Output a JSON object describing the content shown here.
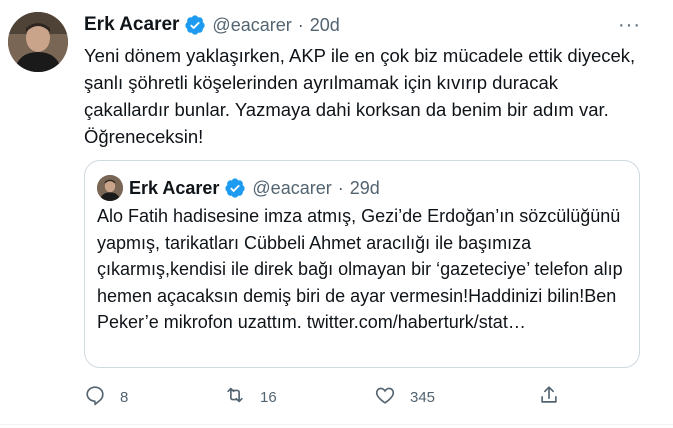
{
  "tweet": {
    "author_name": "Erk Acarer",
    "handle": "@eacarer",
    "separator": "·",
    "time": "20d",
    "more": "···",
    "text": "Yeni dönem yaklaşırken, AKP ile en çok biz mücadele ettik diyecek, şanlı şöhretli köşelerinden ayrılmamak için kıvırıp duracak çakallardır bunlar. Yazmaya dahi korksan da benim bir adım var. Öğreneceksin!"
  },
  "quoted": {
    "author_name": "Erk Acarer",
    "handle": "@eacarer",
    "separator": "·",
    "time": "29d",
    "text": "Alo Fatih hadisesine imza atmış, Gezi’de Erdoğan’ın sözcülüğünü yapmış, tarikatları Cübbeli Ahmet aracılığı ile başımıza çıkarmış,kendisi ile direk bağı olmayan bir ‘gazeteciye’ telefon alıp hemen açacaksın demiş biri de ayar vermesin!Haddinizi bilin!Ben Peker’e mikrofon uzattım. twitter.com/haberturk/stat…"
  },
  "actions": {
    "reply_count": "8",
    "retweet_count": "16",
    "like_count": "345"
  },
  "colors": {
    "verified": "#1d9bf0",
    "secondary_text": "#536471",
    "border": "#cfd9de"
  }
}
